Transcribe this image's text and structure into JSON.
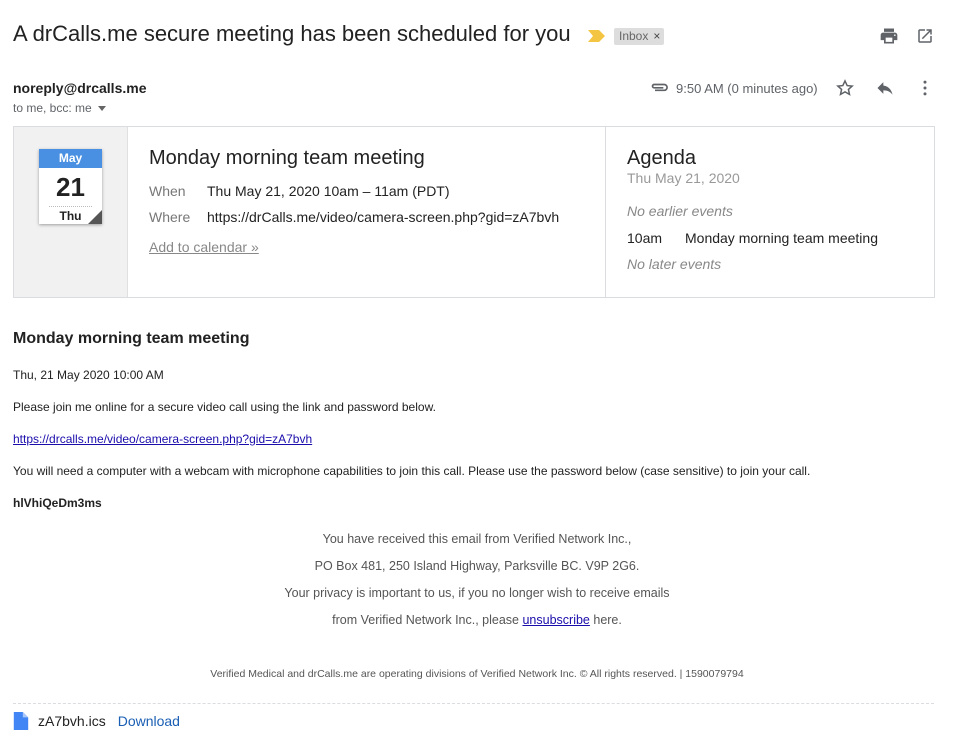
{
  "header": {
    "subject": "A drCalls.me secure meeting has been scheduled for you",
    "label_chip": "Inbox",
    "label_chip_close": "×",
    "important_color": "#f4c542",
    "icons": [
      "print-icon",
      "open-in-new-window-icon"
    ]
  },
  "message": {
    "sender": "noreply@drcalls.me",
    "recipients": "to me, bcc: me",
    "time": "9:50 AM (0 minutes ago)",
    "icons": [
      "attachment-icon",
      "star-icon",
      "reply-icon",
      "more-options-icon"
    ]
  },
  "invite": {
    "calendar": {
      "month": "May",
      "day": "21",
      "weekday": "Thu",
      "accent": "#4a90e2"
    },
    "title": "Monday morning team meeting",
    "when_label": "When",
    "when_value": "Thu May 21, 2020 10am – 11am (PDT)",
    "where_label": "Where",
    "where_value": "https://drCalls.me/video/camera-screen.php?gid=zA7bvh",
    "add_to_calendar": "Add to calendar »",
    "agenda": {
      "title": "Agenda",
      "date": "Thu May 21, 2020",
      "no_earlier": "No earlier events",
      "event_time": "10am",
      "event_title": "Monday morning team meeting",
      "no_later": "No later events"
    }
  },
  "body": {
    "heading": "Monday morning team meeting",
    "datetime": "Thu, 21 May 2020 10:00 AM",
    "intro": "Please join me online for a secure video call using the link and password below.",
    "link": "https://drcalls.me/video/camera-screen.php?gid=zA7bvh",
    "instructions": "You will need a computer with a webcam with microphone capabilities to join this call. Please use the password below (case sensitive) to join your call.",
    "password": "hlVhiQeDm3ms"
  },
  "footer": {
    "line1": "You have received this email from Verified Network Inc.,",
    "line2": "PO Box 481, 250 Island Highway, Parksville BC. V9P 2G6.",
    "line3": "Your privacy is important to us, if you no longer wish to receive emails",
    "line4_before": "from Verified Network Inc., please ",
    "line4_link": "unsubscribe",
    "line4_after": " here.",
    "legal": "Verified Medical and drCalls.me are operating divisions of Verified Network Inc. © All rights reserved. | 1590079794"
  },
  "attachment": {
    "filename": "zA7bvh.ics",
    "download_label": "Download",
    "icon": "file-icon",
    "icon_color": "#4285f4"
  }
}
